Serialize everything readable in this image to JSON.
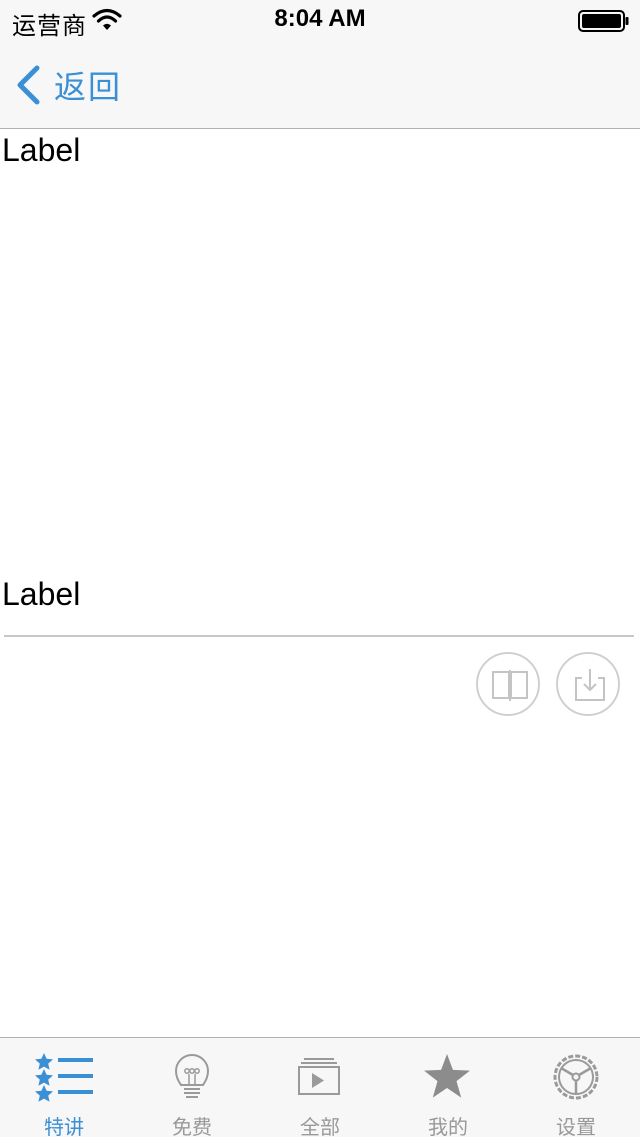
{
  "status_bar": {
    "carrier": "运营商",
    "time": "8:04 AM"
  },
  "nav": {
    "back_label": "返回"
  },
  "content": {
    "label_top": "Label",
    "label_mid": "Label"
  },
  "actions": {
    "read_icon": "open-book-icon",
    "download_icon": "download-tray-icon"
  },
  "tabs": [
    {
      "label": "特讲",
      "icon": "star-list-icon",
      "active": true
    },
    {
      "label": "免费",
      "icon": "lightbulb-icon",
      "active": false
    },
    {
      "label": "全部",
      "icon": "video-stack-icon",
      "active": false
    },
    {
      "label": "我的",
      "icon": "star-icon",
      "active": false
    },
    {
      "label": "设置",
      "icon": "steering-wheel-icon",
      "active": false
    }
  ],
  "colors": {
    "accent": "#3a8fd5",
    "inactive": "#999999",
    "bar_background": "#f7f7f7"
  }
}
